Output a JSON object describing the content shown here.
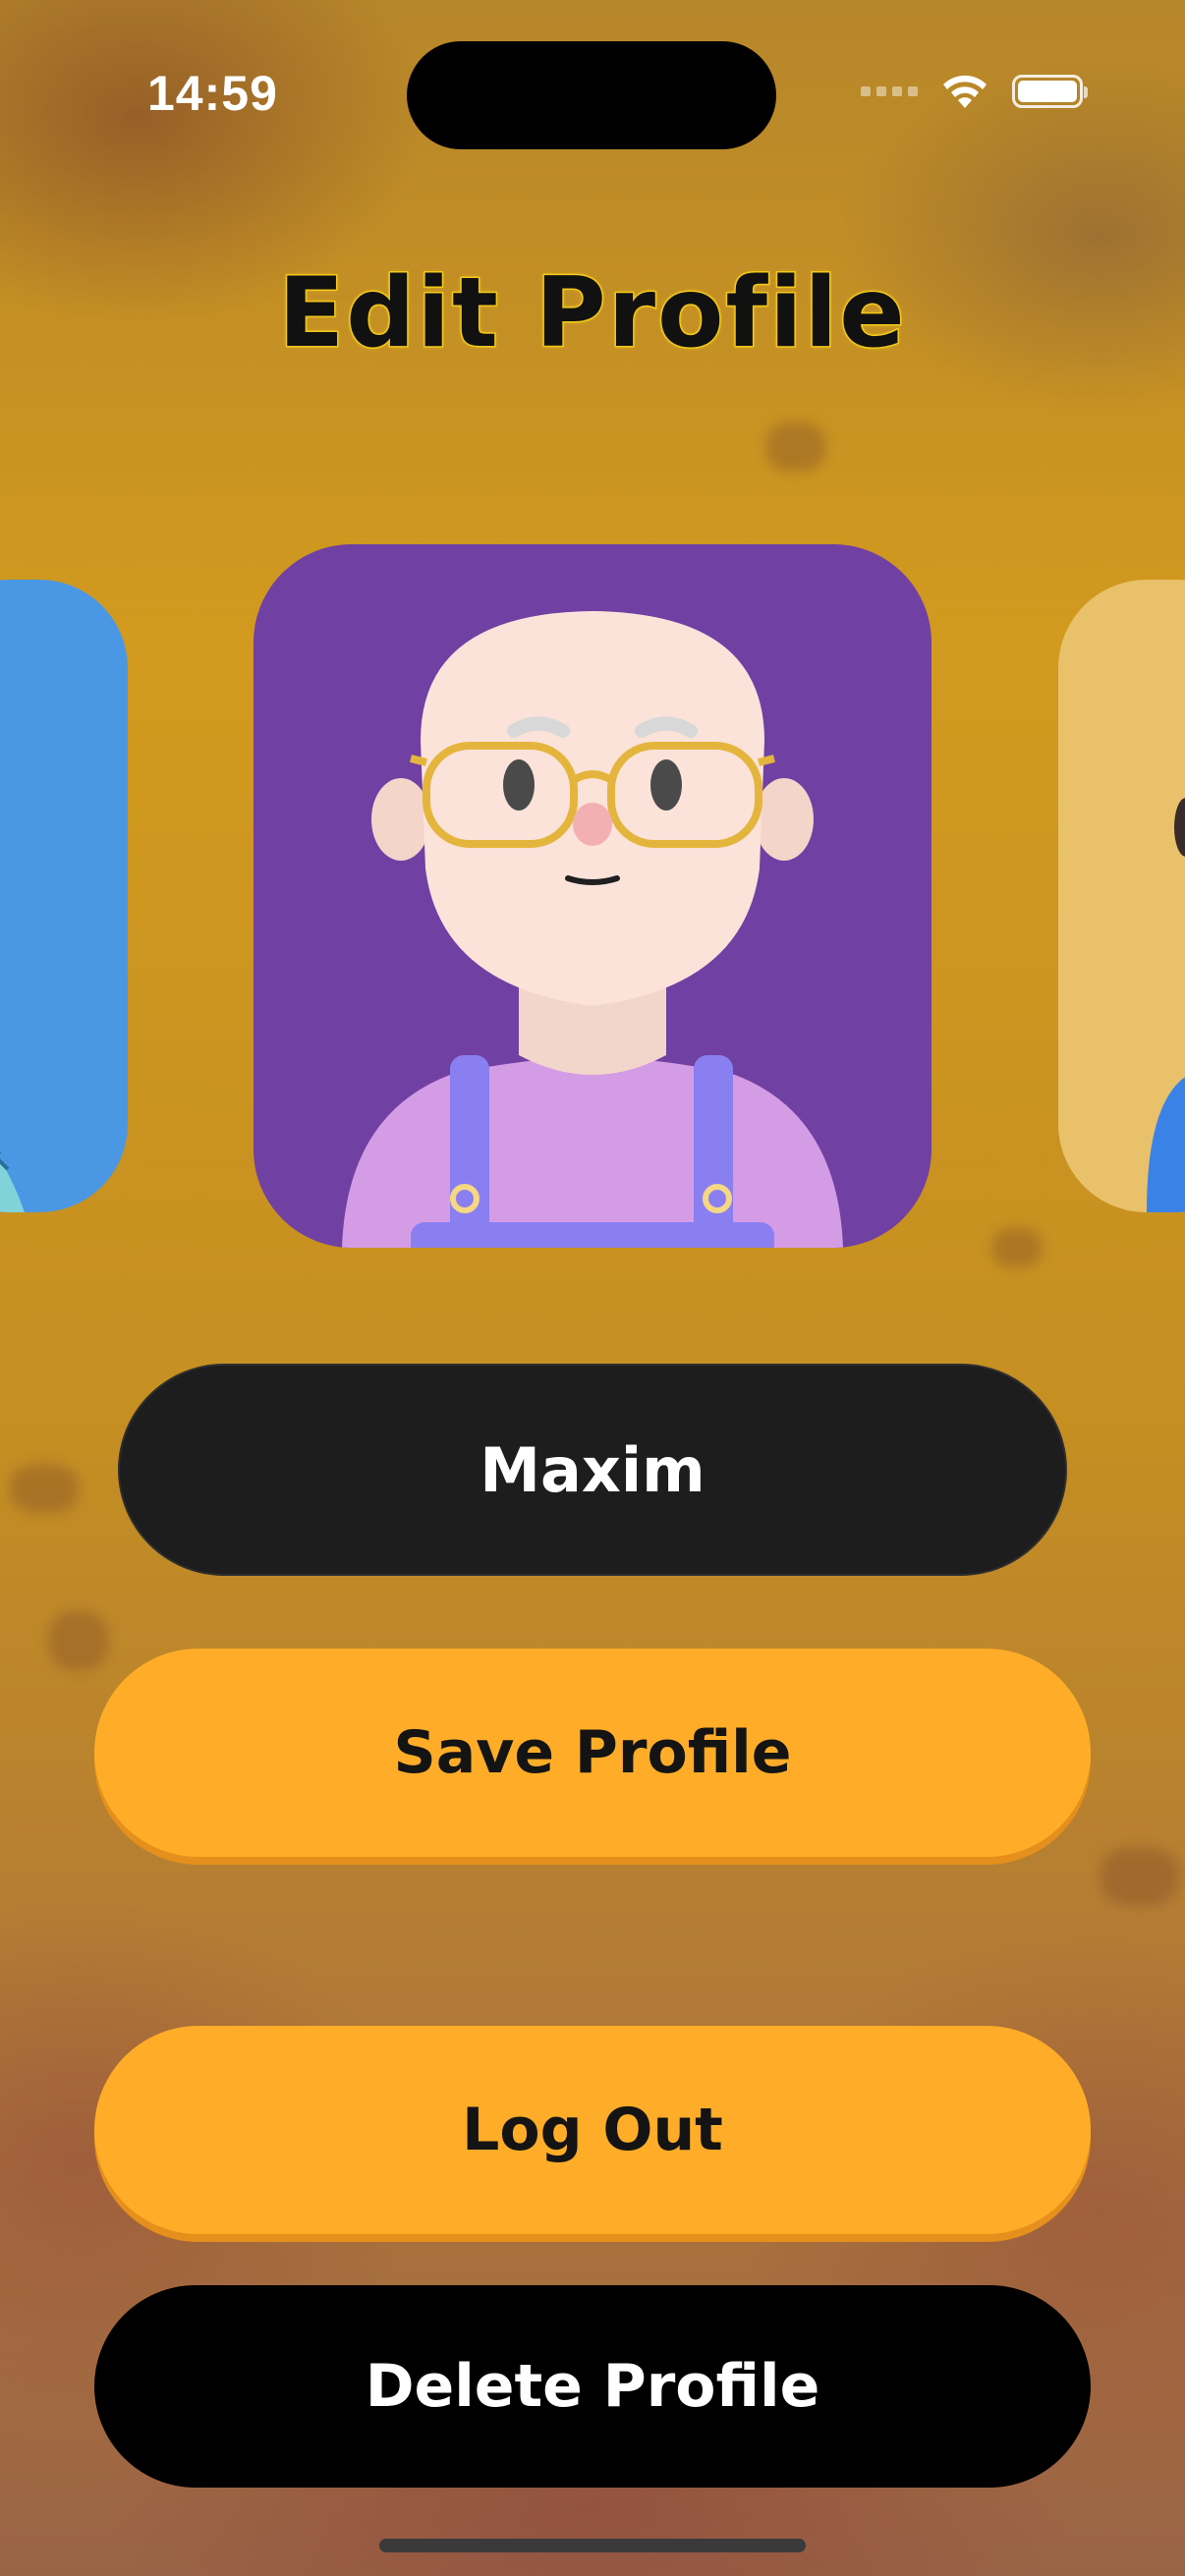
{
  "status_bar": {
    "time": "14:59",
    "wifi_icon": "wifi-icon",
    "battery_icon": "battery-icon"
  },
  "header": {
    "title": "Edit Profile"
  },
  "avatars": {
    "items": [
      {
        "name": "avatar-blue",
        "color": "#4a98e3"
      },
      {
        "name": "avatar-bald-glasses",
        "color": "#7040a3",
        "selected": true
      },
      {
        "name": "avatar-yellow",
        "color": "#e9c16a"
      }
    ]
  },
  "form": {
    "name_value": "Maxim"
  },
  "actions": {
    "save_label": "Save Profile",
    "logout_label": "Log Out",
    "delete_label": "Delete Profile"
  },
  "colors": {
    "accent": "#ffad28",
    "title_outline": "#f2c81c",
    "field_bg": "#1d1d1d",
    "danger_bg": "#000000"
  }
}
